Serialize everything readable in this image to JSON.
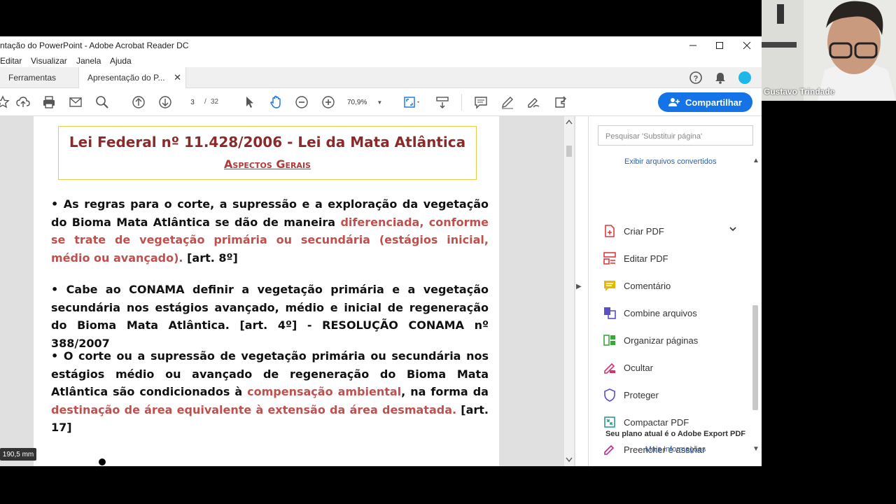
{
  "window": {
    "title": "ntação do PowerPoint - Adobe Acrobat Reader DC"
  },
  "menu": [
    "Editar",
    "Visualizar",
    "Janela",
    "Ajuda"
  ],
  "tabs": {
    "tools": "Ferramentas",
    "document": "Apresentação do P..."
  },
  "toolbar": {
    "current_page": "3",
    "page_separator": "/",
    "total_pages": "32",
    "zoom": "70,9%",
    "share_label": "Compartilhar"
  },
  "slide": {
    "title": "Lei Federal nº 11.428/2006 - Lei da Mata Atlântica",
    "subtitle": "Aspectos Gerais",
    "p1_a": "•  As regras para o corte, a supressão e a exploração da vegetação do Bioma Mata Atlântica se dão de maneira ",
    "p1_b": "diferenciada, conforme se trate de vegetação primária ou secundária (estágios inicial, médio ou avançado).",
    "p1_c": " [art. 8º]",
    "p2": "• Cabe ao CONAMA definir a vegetação primária e a vegetação secundária nos estágios avançado, médio e inicial de regeneração do Bioma Mata Atlântica. [art. 4º]  - RESOLUÇÃO CONAMA nº 388/2007",
    "p3_a": "•  O corte ou a supressão de vegetação primária ou secundária nos estágios médio ou avançado de regeneração do Bioma Mata Atlântica são  condicionados à ",
    "p3_b": "compensação ambiental",
    "p3_c": ", na forma da ",
    "p3_d": "destinação de área equivalente à extensão da área desmatada.",
    "p3_e": " [art. 17]"
  },
  "right_panel": {
    "search_placeholder": "Pesquisar 'Substituir página'",
    "converted_link": "Exibir arquivos convertidos",
    "tools": [
      {
        "label": "Criar PDF",
        "icon": "create-pdf-icon",
        "color": "#e0393e"
      },
      {
        "label": "Editar PDF",
        "icon": "edit-pdf-icon",
        "color": "#e0393e"
      },
      {
        "label": "Comentário",
        "icon": "comment-icon",
        "color": "#e6b800"
      },
      {
        "label": "Combine arquivos",
        "icon": "combine-files-icon",
        "color": "#5b4fc9"
      },
      {
        "label": "Organizar páginas",
        "icon": "organize-pages-icon",
        "color": "#3da53d"
      },
      {
        "label": "Ocultar",
        "icon": "redact-icon",
        "color": "#d6336c"
      },
      {
        "label": "Proteger",
        "icon": "protect-icon",
        "color": "#5b4fc9"
      },
      {
        "label": "Compactar PDF",
        "icon": "compress-pdf-icon",
        "color": "#2a9d8f"
      },
      {
        "label": "Preencher e assinar",
        "icon": "fill-sign-icon",
        "color": "#c2298a"
      }
    ],
    "plan_text": "Seu plano atual é o Adobe Export PDF",
    "more_info": "Mais Informações"
  },
  "measure_tag": "190,5 mm",
  "webcam": {
    "name": "Gustavo Trindade"
  },
  "colors": {
    "accent": "#1473e6",
    "slide_title": "#8b2a2a",
    "highlight": "#c0504d"
  }
}
